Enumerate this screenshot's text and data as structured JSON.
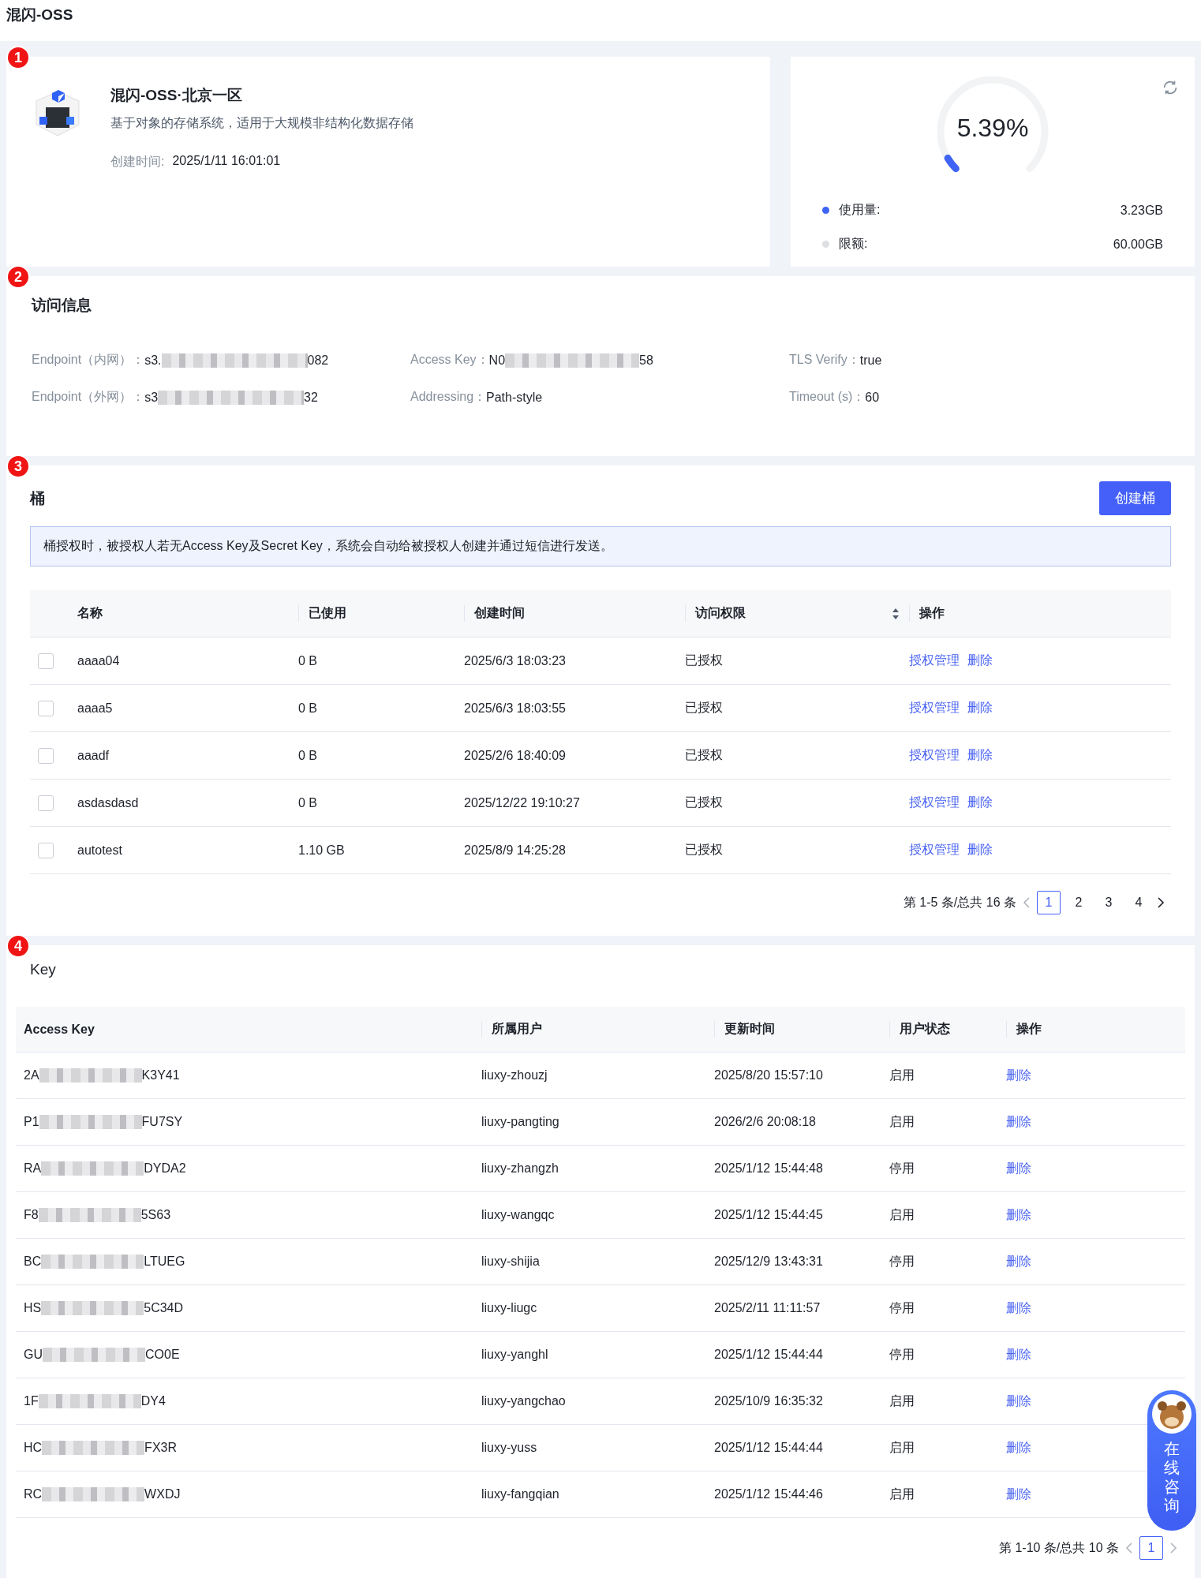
{
  "page_title": "混闪-OSS",
  "overview": {
    "badge": "1",
    "name": "混闪-OSS·北京一区",
    "description": "基于对象的存储系统，适用于大规模非结构化数据存储",
    "created_label": "创建时间:",
    "created_value": "2025/1/11 16:01:01"
  },
  "usage": {
    "percent": "5.39%",
    "level": 0.0539,
    "legend": [
      {
        "label": "使用量:",
        "value": "3.23GB",
        "color": "#3e63f5"
      },
      {
        "label": "限额:",
        "value": "60.00GB",
        "color": "#dddfe3"
      }
    ]
  },
  "access_info": {
    "badge": "2",
    "title": "访问信息",
    "fields": [
      {
        "label": "Endpoint（内网）：",
        "prefix": "s3.",
        "suffix": "082"
      },
      {
        "label": "Access Key：",
        "prefix": "N0",
        "suffix": "58"
      },
      {
        "label": "TLS Verify：",
        "value": "true"
      },
      {
        "label": "Endpoint（外网）：",
        "prefix": "s3",
        "suffix": "32"
      },
      {
        "label": "Addressing：",
        "value": "Path-style"
      },
      {
        "label": "Timeout (s)：",
        "value": "60"
      }
    ]
  },
  "buckets": {
    "badge": "3",
    "title": "桶",
    "create_button": "创建桶",
    "notice": "桶授权时，被授权人若无Access Key及Secret Key，系统会自动给被授权人创建并通过短信进行发送。",
    "columns": [
      "名称",
      "已使用",
      "创建时间",
      "访问权限",
      "操作"
    ],
    "rows": [
      {
        "checked": false,
        "name": "aaaa04",
        "used": "0 B",
        "created": "2025/6/3 18:03:23",
        "access": "已授权",
        "actions": [
          "授权管理",
          "删除"
        ]
      },
      {
        "checked": false,
        "name": "aaaa5",
        "used": "0 B",
        "created": "2025/6/3 18:03:55",
        "access": "已授权",
        "actions": [
          "授权管理",
          "删除"
        ]
      },
      {
        "checked": false,
        "name": "aaadf",
        "used": "0 B",
        "created": "2025/2/6 18:40:09",
        "access": "已授权",
        "actions": [
          "授权管理",
          "删除"
        ]
      },
      {
        "checked": false,
        "name": "asdasdasd",
        "used": "0 B",
        "created": "2025/12/22 19:10:27",
        "access": "已授权",
        "actions": [
          "授权管理",
          "删除"
        ]
      },
      {
        "checked": false,
        "name": "autotest",
        "used": "1.10 GB",
        "created": "2025/8/9 14:25:28",
        "access": "已授权",
        "actions": [
          "授权管理",
          "删除"
        ]
      }
    ],
    "pagination": {
      "summary": "第 1-5 条/总共 16 条",
      "pages": [
        {
          "label": "1",
          "selected": true
        },
        {
          "label": "2",
          "selected": false
        },
        {
          "label": "3",
          "selected": false
        },
        {
          "label": "4",
          "selected": false
        }
      ]
    }
  },
  "keys": {
    "badge": "4",
    "title": "Key",
    "columns": [
      "Access Key",
      "所属用户",
      "更新时间",
      "用户状态",
      "操作"
    ],
    "rows": [
      {
        "key_prefix": "2A",
        "key_suffix": "K3Y41",
        "user": "liuxy-zhouzj",
        "updated": "2025/8/20 15:57:10",
        "status": "启用",
        "action": "删除"
      },
      {
        "key_prefix": "P1",
        "key_suffix": "FU7SY",
        "user": "liuxy-pangting",
        "updated": "2026/2/6 20:08:18",
        "status": "启用",
        "action": "删除"
      },
      {
        "key_prefix": "RA",
        "key_suffix": "DYDA2",
        "user": "liuxy-zhangzh",
        "updated": "2025/1/12 15:44:48",
        "status": "停用",
        "action": "删除"
      },
      {
        "key_prefix": "F8",
        "key_suffix": "5S63",
        "user": "liuxy-wangqc",
        "updated": "2025/1/12 15:44:45",
        "status": "启用",
        "action": "删除"
      },
      {
        "key_prefix": "BC",
        "key_suffix": "LTUEG",
        "user": "liuxy-shijia",
        "updated": "2025/12/9 13:43:31",
        "status": "停用",
        "action": "删除"
      },
      {
        "key_prefix": "HS",
        "key_suffix": "5C34D",
        "user": "liuxy-liugc",
        "updated": "2025/2/11 11:11:57",
        "status": "停用",
        "action": "删除"
      },
      {
        "key_prefix": "GU",
        "key_suffix": "CO0E",
        "user": "liuxy-yanghl",
        "updated": "2025/1/12 15:44:44",
        "status": "停用",
        "action": "删除"
      },
      {
        "key_prefix": "1F",
        "key_suffix": "DY4",
        "user": "liuxy-yangchao",
        "updated": "2025/10/9 16:35:32",
        "status": "启用",
        "action": "删除"
      },
      {
        "key_prefix": "HC",
        "key_suffix": "FX3R",
        "user": "liuxy-yuss",
        "updated": "2025/1/12 15:44:44",
        "status": "启用",
        "action": "删除"
      },
      {
        "key_prefix": "RC",
        "key_suffix": "WXDJ",
        "user": "liuxy-fangqian",
        "updated": "2025/1/12 15:44:46",
        "status": "启用",
        "action": "删除"
      }
    ],
    "pagination": {
      "summary": "第 1-10 条/总共 10 条",
      "pages": [
        {
          "label": "1",
          "selected": true
        }
      ]
    }
  },
  "chat_widget": {
    "label": "在线咨询"
  }
}
